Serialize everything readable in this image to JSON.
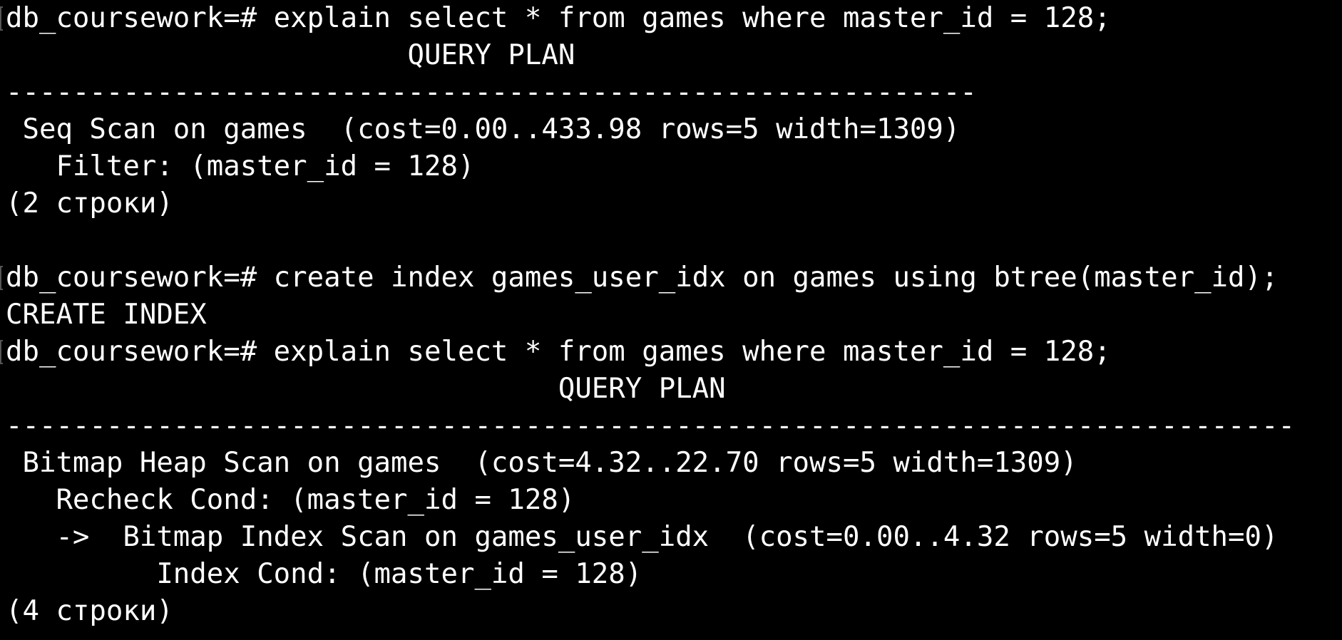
{
  "terminal": {
    "lines": [
      {
        "text": "db_coursework=# explain select * from games where master_id = 128;",
        "prompt": true
      },
      {
        "text": "                        QUERY PLAN",
        "prompt": false
      },
      {
        "text": "----------------------------------------------------------",
        "prompt": false
      },
      {
        "text": " Seq Scan on games  (cost=0.00..433.98 rows=5 width=1309)",
        "prompt": false
      },
      {
        "text": "   Filter: (master_id = 128)",
        "prompt": false
      },
      {
        "text": "(2 строки)",
        "prompt": false
      },
      {
        "text": "",
        "prompt": false
      },
      {
        "text": "db_coursework=# create index games_user_idx on games using btree(master_id);",
        "prompt": true
      },
      {
        "text": "CREATE INDEX",
        "prompt": false
      },
      {
        "text": "db_coursework=# explain select * from games where master_id = 128;",
        "prompt": true
      },
      {
        "text": "                                 QUERY PLAN",
        "prompt": false
      },
      {
        "text": "-----------------------------------------------------------------------------",
        "prompt": false
      },
      {
        "text": " Bitmap Heap Scan on games  (cost=4.32..22.70 rows=5 width=1309)",
        "prompt": false
      },
      {
        "text": "   Recheck Cond: (master_id = 128)",
        "prompt": false
      },
      {
        "text": "   ->  Bitmap Index Scan on games_user_idx  (cost=0.00..4.32 rows=5 width=0)",
        "prompt": false
      },
      {
        "text": "         Index Cond: (master_id = 128)",
        "prompt": false
      },
      {
        "text": "(4 строки)",
        "prompt": false
      }
    ]
  },
  "colors": {
    "background": "#000000",
    "foreground": "#ffffff"
  }
}
